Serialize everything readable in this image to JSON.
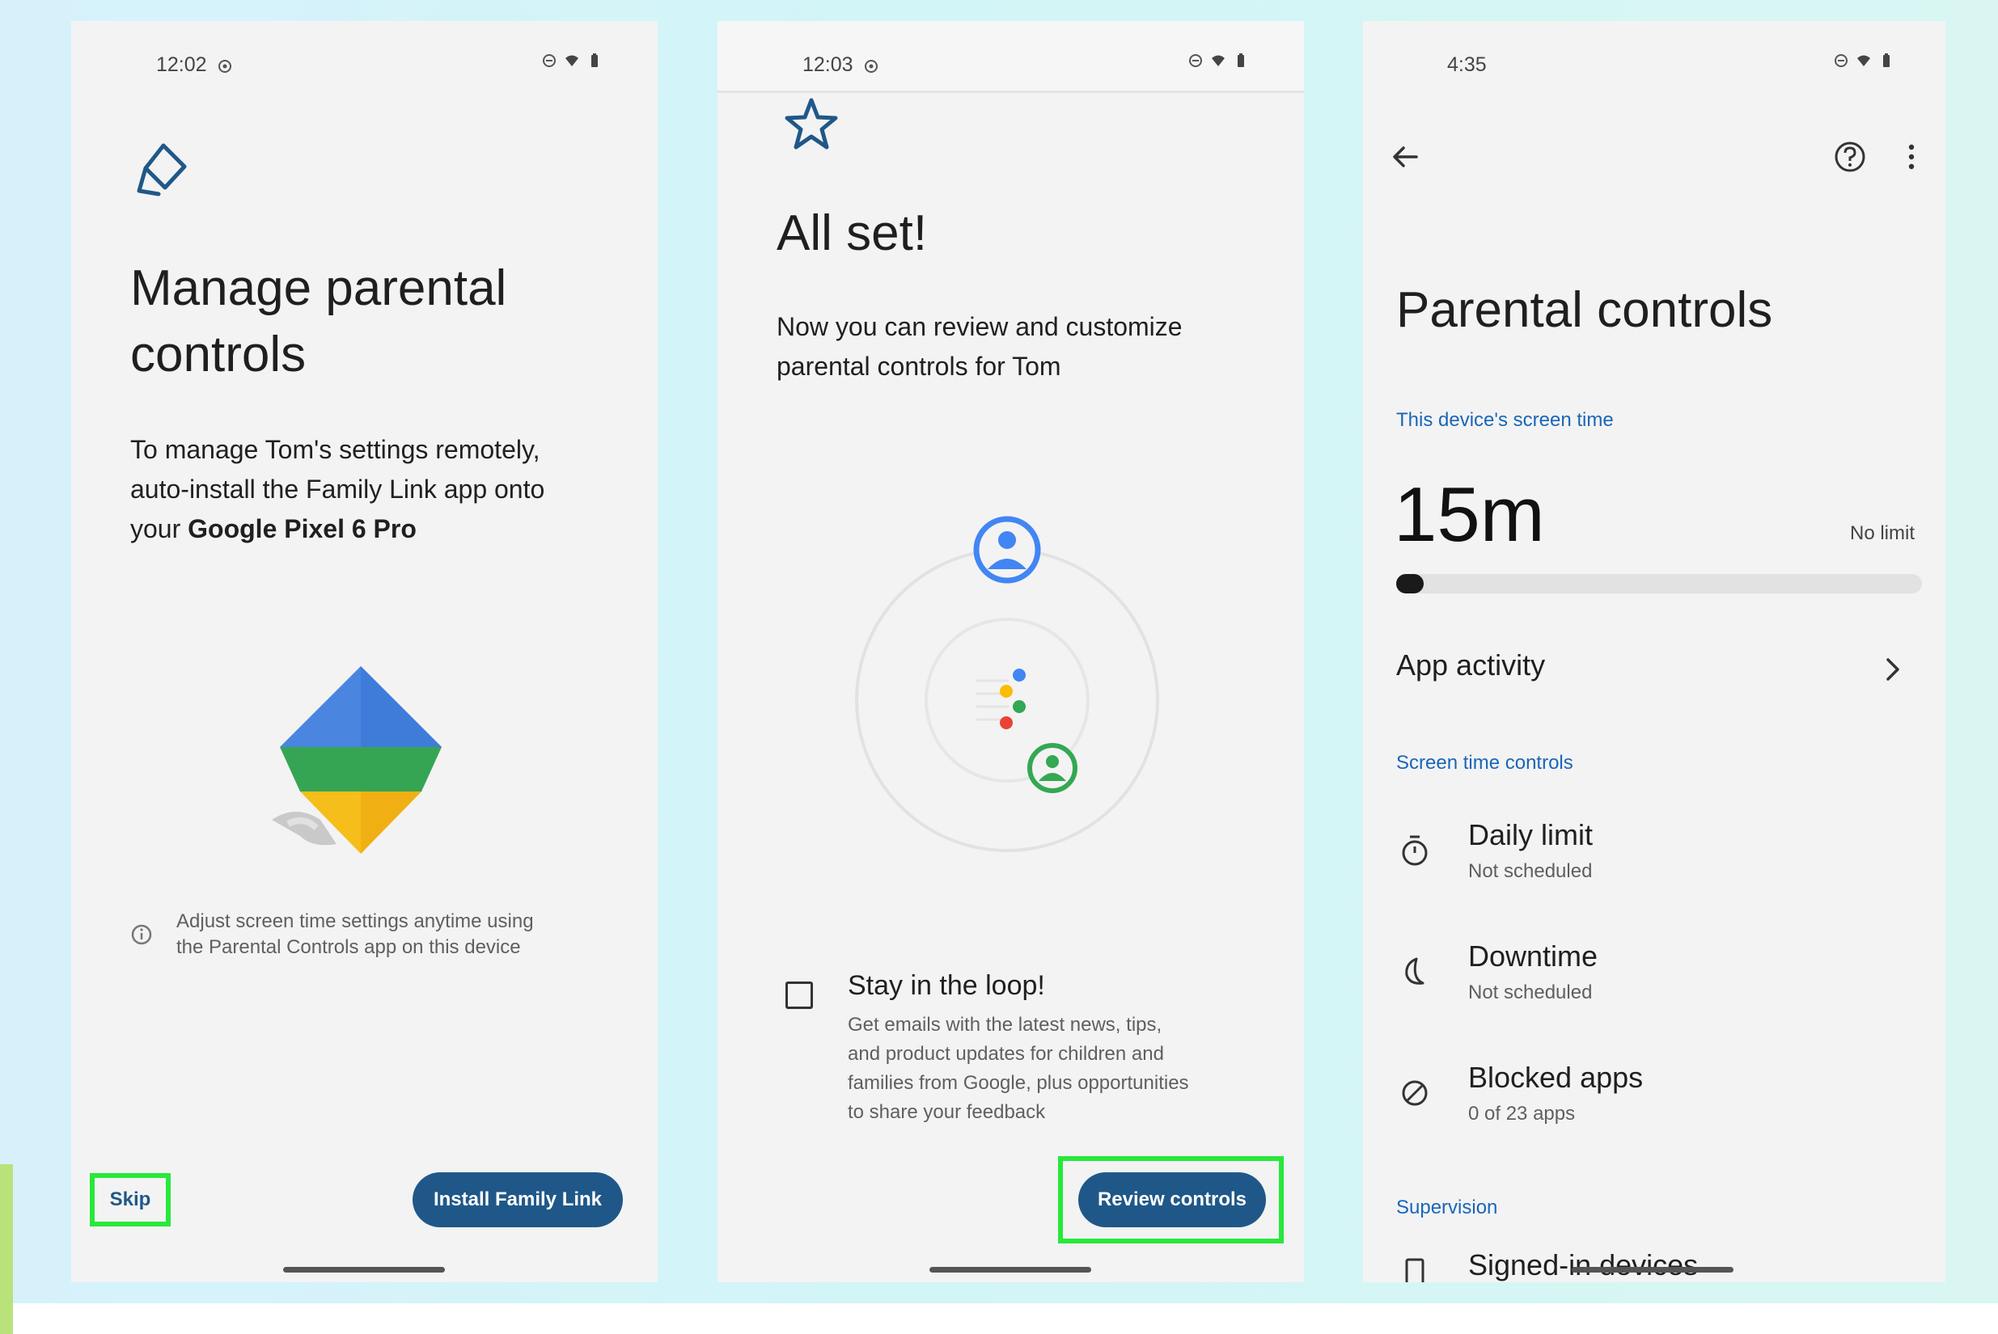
{
  "screen1": {
    "time": "12:02",
    "title_line1": "Manage parental",
    "title_line2": "controls",
    "body_line1": "To manage Tom's settings remotely,",
    "body_line2": "auto-install the Family Link app onto",
    "body_prefix": "your ",
    "body_bold": "Google Pixel 6 Pro",
    "info_line1": "Adjust screen time settings anytime using",
    "info_line2": "the Parental Controls app on this device",
    "skip_label": "Skip",
    "install_label": "Install Family Link"
  },
  "screen2": {
    "time": "12:03",
    "title": "All set!",
    "body_line1": "Now you can review and customize",
    "body_line2": "parental controls for Tom",
    "loop_title": "Stay in the loop!",
    "loop_line1": "Get emails with the latest news, tips,",
    "loop_line2": "and product updates for children and",
    "loop_line3": "families from Google, plus opportunities",
    "loop_line4": "to share your feedback",
    "review_label": "Review controls"
  },
  "screen3": {
    "time": "4:35",
    "title": "Parental controls",
    "screen_time_label": "This device's screen time",
    "screen_time_value": "15m",
    "no_limit": "No limit",
    "usage_fraction": 0.05,
    "app_activity": "App activity",
    "controls_label": "Screen time controls",
    "rows": [
      {
        "title": "Daily limit",
        "sub": "Not scheduled",
        "icon": "timer-icon"
      },
      {
        "title": "Downtime",
        "sub": "Not scheduled",
        "icon": "moon-icon"
      },
      {
        "title": "Blocked apps",
        "sub": "0 of 23 apps",
        "icon": "block-icon"
      }
    ],
    "supervision_label": "Supervision",
    "signed_in": "Signed-in devices"
  },
  "colors": {
    "accent_blue": "#1f5888",
    "link_blue": "#1a66b8",
    "highlight_green": "#28e83a"
  }
}
